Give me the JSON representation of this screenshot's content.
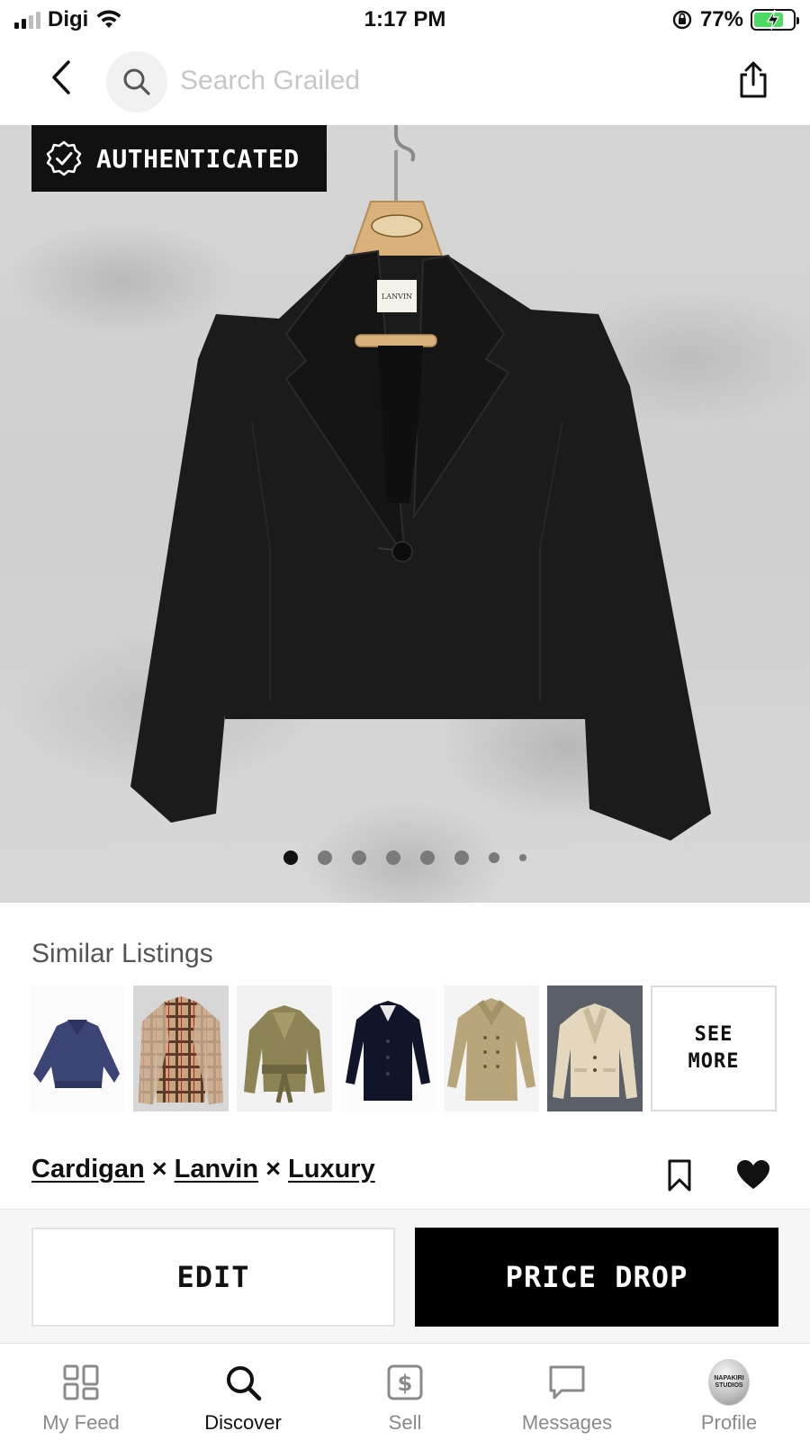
{
  "status_bar": {
    "carrier": "Digi",
    "time": "1:17 PM",
    "battery_percent": "77%",
    "battery_level": 0.77
  },
  "search": {
    "placeholder": "Search Grailed"
  },
  "hero": {
    "badge_label": "AUTHENTICATED",
    "hanger_text": "LANVIN",
    "total_images": 8,
    "active_index": 0
  },
  "similar": {
    "title": "Similar Listings",
    "see_more_line1": "SEE",
    "see_more_line2": "MORE",
    "items": [
      {
        "icon": "navy-bomber-jacket"
      },
      {
        "icon": "plaid-check-coat"
      },
      {
        "icon": "olive-satin-jacket"
      },
      {
        "icon": "navy-long-coat"
      },
      {
        "icon": "beige-trench-coat"
      },
      {
        "icon": "cream-blazer"
      }
    ]
  },
  "listing": {
    "brands": [
      "Cardigan",
      "Lanvin",
      "Luxury"
    ],
    "separator": "×"
  },
  "actions": {
    "edit": "EDIT",
    "price_drop": "PRICE DROP"
  },
  "tabs": [
    {
      "label": "My Feed",
      "icon": "feed-grid-icon"
    },
    {
      "label": "Discover",
      "icon": "search-icon"
    },
    {
      "label": "Sell",
      "icon": "sell-dollar-icon"
    },
    {
      "label": "Messages",
      "icon": "message-bubble-icon"
    },
    {
      "label": "Profile",
      "icon": "avatar",
      "avatar_text": "NAPAKIRI STUDIOS"
    }
  ],
  "active_tab": "Discover"
}
